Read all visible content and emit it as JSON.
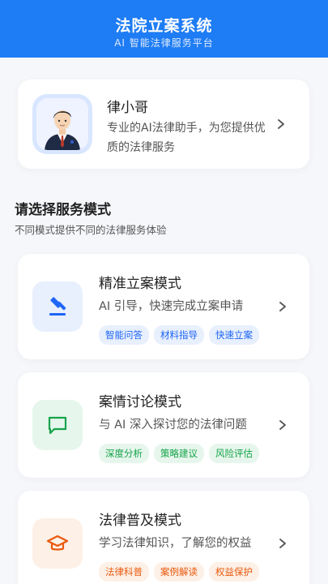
{
  "header": {
    "title": "法院立案系统",
    "subtitle": "AI 智能法律服务平台"
  },
  "assistant": {
    "name": "律小哥",
    "description": "专业的AI法律助手，为您提供优质的法律服务",
    "avatar_icon": "lawyer-avatar"
  },
  "section": {
    "title": "请选择服务模式",
    "subtitle": "不同模式提供不同的法律服务体验"
  },
  "modes": [
    {
      "title": "精准立案模式",
      "description": "AI 引导，快速完成立案申请",
      "icon": "gavel-icon",
      "accent": "#1e66f5",
      "icon_bg": "#e8effd",
      "tag_bg": "#e8effd",
      "tags": [
        "智能问答",
        "材料指导",
        "快速立案"
      ]
    },
    {
      "title": "案情讨论模式",
      "description": "与 AI 深入探讨您的法律问题",
      "icon": "chat-icon",
      "accent": "#16a34a",
      "icon_bg": "#e6f6ec",
      "tag_bg": "#e6f6ec",
      "tags": [
        "深度分析",
        "策略建议",
        "风险评估"
      ]
    },
    {
      "title": "法律普及模式",
      "description": "学习法律知识，了解您的权益",
      "icon": "graduation-cap-icon",
      "accent": "#ea580c",
      "icon_bg": "#fdf0e6",
      "tag_bg": "#fdf0e6",
      "tags": [
        "法律科普",
        "案例解读",
        "权益保护"
      ]
    }
  ]
}
